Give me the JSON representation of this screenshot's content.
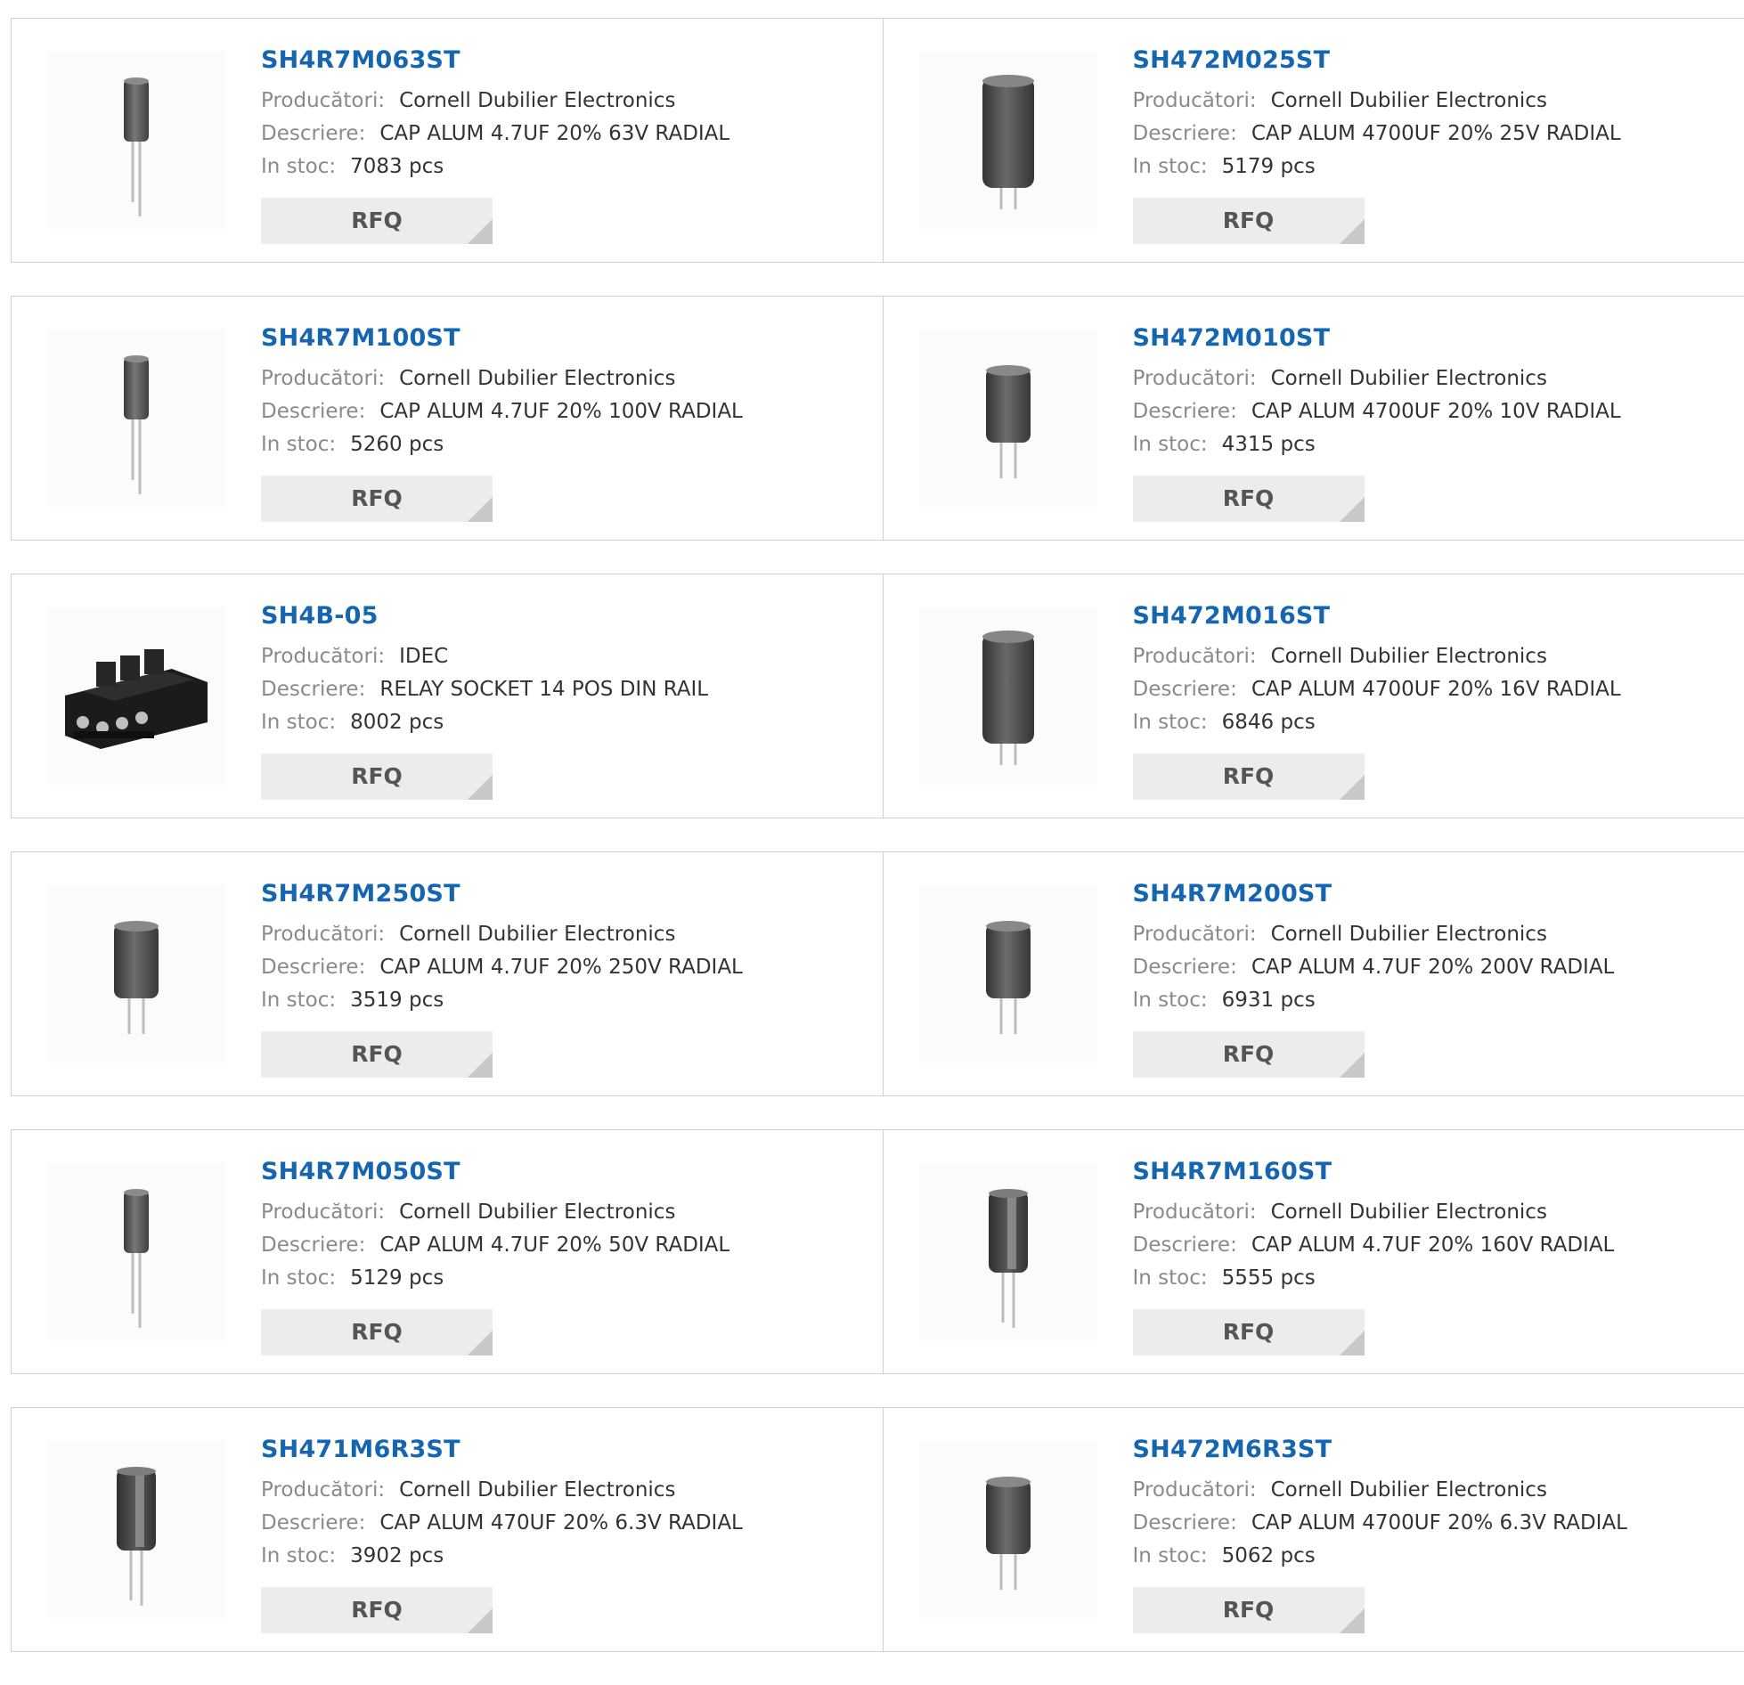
{
  "labels": {
    "manufacturer": "Producători:",
    "description": "Descriere:",
    "stock": "In stoc:",
    "rfq": "RFQ"
  },
  "products": [
    {
      "part": "SH4R7M063ST",
      "manufacturer": "Cornell Dubilier Electronics",
      "description": "CAP ALUM 4.7UF 20% 63V RADIAL",
      "stock": "7083 pcs",
      "icon": "capacitor-thin-icon"
    },
    {
      "part": "SH472M025ST",
      "manufacturer": "Cornell Dubilier Electronics",
      "description": "CAP ALUM 4700UF 20% 25V RADIAL",
      "stock": "5179 pcs",
      "icon": "capacitor-large-icon"
    },
    {
      "part": "SH4R7M100ST",
      "manufacturer": "Cornell Dubilier Electronics",
      "description": "CAP ALUM 4.7UF 20% 100V RADIAL",
      "stock": "5260 pcs",
      "icon": "capacitor-thin-icon"
    },
    {
      "part": "SH472M010ST",
      "manufacturer": "Cornell Dubilier Electronics",
      "description": "CAP ALUM 4700UF 20% 10V RADIAL",
      "stock": "4315 pcs",
      "icon": "capacitor-medium-icon"
    },
    {
      "part": "SH4B-05",
      "manufacturer": "IDEC",
      "description": "RELAY SOCKET 14 POS DIN RAIL",
      "stock": "8002 pcs",
      "icon": "relay-socket-icon"
    },
    {
      "part": "SH472M016ST",
      "manufacturer": "Cornell Dubilier Electronics",
      "description": "CAP ALUM 4700UF 20% 16V RADIAL",
      "stock": "6846 pcs",
      "icon": "capacitor-large-icon"
    },
    {
      "part": "SH4R7M250ST",
      "manufacturer": "Cornell Dubilier Electronics",
      "description": "CAP ALUM 4.7UF 20% 250V RADIAL",
      "stock": "3519 pcs",
      "icon": "capacitor-medium-icon"
    },
    {
      "part": "SH4R7M200ST",
      "manufacturer": "Cornell Dubilier Electronics",
      "description": "CAP ALUM 4.7UF 20% 200V RADIAL",
      "stock": "6931 pcs",
      "icon": "capacitor-medium-icon"
    },
    {
      "part": "SH4R7M050ST",
      "manufacturer": "Cornell Dubilier Electronics",
      "description": "CAP ALUM 4.7UF 20% 50V RADIAL",
      "stock": "5129 pcs",
      "icon": "capacitor-thin-icon"
    },
    {
      "part": "SH4R7M160ST",
      "manufacturer": "Cornell Dubilier Electronics",
      "description": "CAP ALUM 4.7UF 20% 160V RADIAL",
      "stock": "5555 pcs",
      "icon": "capacitor-striped-icon"
    },
    {
      "part": "SH471M6R3ST",
      "manufacturer": "Cornell Dubilier Electronics",
      "description": "CAP ALUM 470UF 20% 6.3V RADIAL",
      "stock": "3902 pcs",
      "icon": "capacitor-striped-icon"
    },
    {
      "part": "SH472M6R3ST",
      "manufacturer": "Cornell Dubilier Electronics",
      "description": "CAP ALUM 4700UF 20% 6.3V RADIAL",
      "stock": "5062 pcs",
      "icon": "capacitor-medium-icon"
    }
  ]
}
